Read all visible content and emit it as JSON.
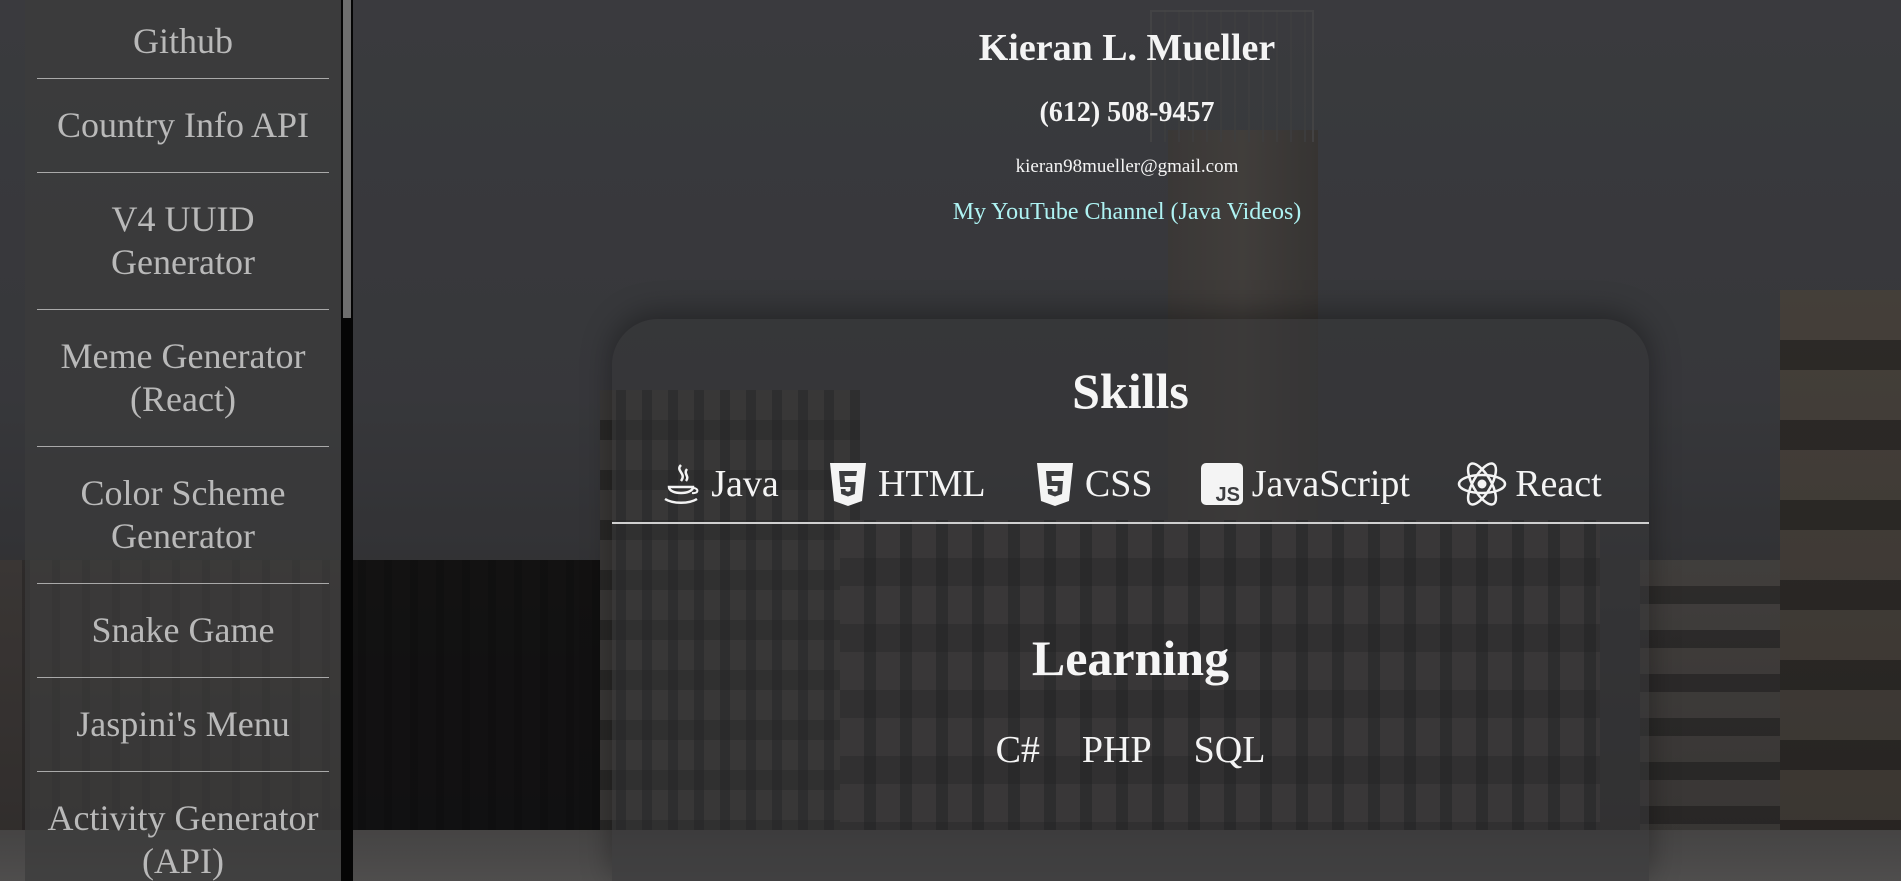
{
  "sidebar": {
    "items": [
      {
        "label": "Github"
      },
      {
        "label": "Country Info API"
      },
      {
        "label": "V4 UUID Generator",
        "lines": [
          "V4 UUID",
          "Generator"
        ]
      },
      {
        "label": "Meme Generator (React)",
        "lines": [
          "Meme Generator",
          "(React)"
        ]
      },
      {
        "label": "Color Scheme Generator",
        "lines": [
          "Color Scheme",
          "Generator"
        ]
      },
      {
        "label": "Snake Game"
      },
      {
        "label": "Jaspini's Menu"
      },
      {
        "label": "Activity Generator (API)",
        "lines": [
          "Activity Generator",
          "(API)"
        ]
      }
    ]
  },
  "header": {
    "name": "Kieran L. Mueller",
    "phone": "(612) 508-9457",
    "email": "kieran98mueller@gmail.com",
    "youtube_link": "My YouTube Channel (Java Videos)"
  },
  "skills": {
    "title": "Skills",
    "items": [
      {
        "label": "Java",
        "icon": "java-icon"
      },
      {
        "label": "HTML",
        "icon": "html5-icon"
      },
      {
        "label": "CSS",
        "icon": "css3-icon"
      },
      {
        "label": "JavaScript",
        "icon": "javascript-icon"
      },
      {
        "label": "React",
        "icon": "react-icon"
      }
    ]
  },
  "learning": {
    "title": "Learning",
    "items": [
      "C#",
      "PHP",
      "SQL"
    ]
  },
  "colors": {
    "link": "#aef3f3",
    "text": "#f4f4f4",
    "sidebar_text": "#b9b9b9"
  }
}
